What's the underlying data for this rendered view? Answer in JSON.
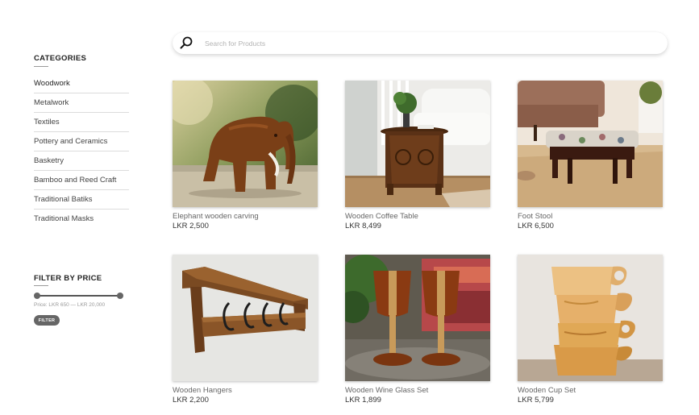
{
  "search": {
    "placeholder": "Search for Products",
    "value": ""
  },
  "sidebar": {
    "categories_heading": "CATEGORIES",
    "categories": [
      "Woodwork",
      "Metalwork",
      "Textiles",
      "Pottery and Ceramics",
      "Basketry",
      "Bamboo and Reed Craft",
      "Traditional Batiks",
      "Traditional Masks"
    ],
    "filter_heading": "FILTER BY PRICE",
    "price_label": "Price: LKR 650 — LKR 20,000",
    "price_min": 650,
    "price_max": 20000,
    "filter_button": "FILTER"
  },
  "products": [
    {
      "name": "Elephant wooden carving",
      "price": "LKR 2,500",
      "image": "elephant-carving"
    },
    {
      "name": "Wooden Coffee Table",
      "price": "LKR 8,499",
      "image": "coffee-table"
    },
    {
      "name": "Foot Stool",
      "price": "LKR 6,500",
      "image": "foot-stool"
    },
    {
      "name": "Wooden Hangers",
      "price": "LKR 2,200",
      "image": "wall-hangers"
    },
    {
      "name": "Wooden Wine Glass Set",
      "price": "LKR 1,899",
      "image": "wine-glasses"
    },
    {
      "name": "Wooden Cup Set",
      "price": "LKR 5,799",
      "image": "stacked-cups"
    }
  ]
}
